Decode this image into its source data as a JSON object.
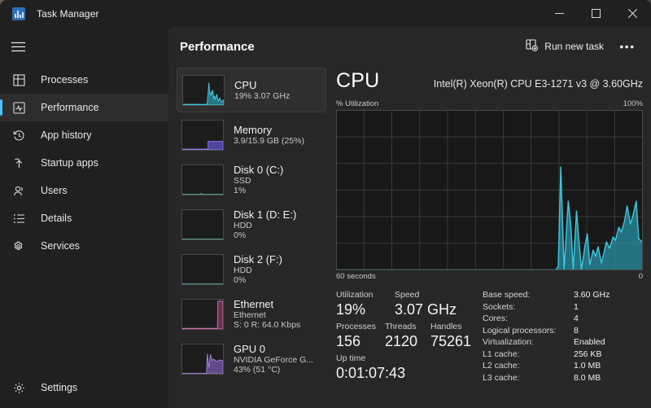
{
  "window": {
    "title": "Task Manager",
    "app_icon": "task-manager-icon",
    "minimize_label": "Minimize",
    "maximize_label": "Maximize",
    "close_label": "Close"
  },
  "sidebar": {
    "menu_icon": "hamburger-icon",
    "items": [
      {
        "label": "Processes",
        "icon": "processes-icon",
        "selected": false
      },
      {
        "label": "Performance",
        "icon": "performance-icon",
        "selected": true
      },
      {
        "label": "App history",
        "icon": "history-icon",
        "selected": false
      },
      {
        "label": "Startup apps",
        "icon": "startup-icon",
        "selected": false
      },
      {
        "label": "Users",
        "icon": "users-icon",
        "selected": false
      },
      {
        "label": "Details",
        "icon": "details-icon",
        "selected": false
      },
      {
        "label": "Services",
        "icon": "services-icon",
        "selected": false
      }
    ],
    "settings": {
      "label": "Settings",
      "icon": "gear-icon"
    }
  },
  "header": {
    "title": "Performance",
    "run_new_task": "Run new task",
    "run_new_task_icon": "run-new-task-icon",
    "more_label": "•••"
  },
  "resources": [
    {
      "name": "CPU",
      "line1": "19%  3.07 GHz",
      "line2": "",
      "selected": true,
      "color": "#3ec8e0"
    },
    {
      "name": "Memory",
      "line1": "3.9/15.9 GB (25%)",
      "line2": "",
      "selected": false,
      "color": "#8f7fe8"
    },
    {
      "name": "Disk 0 (C:)",
      "line1": "SSD",
      "line2": "1%",
      "selected": false,
      "color": "#4f9e8f"
    },
    {
      "name": "Disk 1 (D: E:)",
      "line1": "HDD",
      "line2": "0%",
      "selected": false,
      "color": "#4f9e8f"
    },
    {
      "name": "Disk 2 (F:)",
      "line1": "HDD",
      "line2": "0%",
      "selected": false,
      "color": "#4f9e8f"
    },
    {
      "name": "Ethernet",
      "line1": "Ethernet",
      "line2": "S: 0 R: 64.0 Kbps",
      "selected": false,
      "color": "#d96fb0"
    },
    {
      "name": "GPU 0",
      "line1": "NVIDIA GeForce G...",
      "line2": "43% (51 °C)",
      "selected": false,
      "color": "#a585d8"
    }
  ],
  "cpu": {
    "title": "CPU",
    "model": "Intel(R) Xeon(R) CPU E3-1271 v3 @ 3.60GHz",
    "graph_label": "% Utilization",
    "graph_max": "100%",
    "axis_left": "60 seconds",
    "axis_right": "0",
    "accent": "#3ec8e0",
    "stats": {
      "utilization_label": "Utilization",
      "utilization_value": "19%",
      "speed_label": "Speed",
      "speed_value": "3.07 GHz",
      "processes_label": "Processes",
      "processes_value": "156",
      "threads_label": "Threads",
      "threads_value": "2120",
      "handles_label": "Handles",
      "handles_value": "75261",
      "uptime_label": "Up time",
      "uptime_value": "0:01:07:43"
    },
    "specs": [
      {
        "key": "Base speed:",
        "value": "3.60 GHz"
      },
      {
        "key": "Sockets:",
        "value": "1"
      },
      {
        "key": "Cores:",
        "value": "4"
      },
      {
        "key": "Logical processors:",
        "value": "8"
      },
      {
        "key": "Virtualization:",
        "value": "Enabled"
      },
      {
        "key": "L1 cache:",
        "value": "256 KB"
      },
      {
        "key": "L2 cache:",
        "value": "1.0 MB"
      },
      {
        "key": "L3 cache:",
        "value": "8.0 MB"
      }
    ]
  },
  "chart_data": {
    "type": "area",
    "title": "% Utilization",
    "xlabel": "60 seconds",
    "ylabel": "% Utilization",
    "ylim": [
      0,
      100
    ],
    "xlim": [
      60,
      0
    ],
    "grid": true,
    "accent_color": "#3ec8e0",
    "note": "History only populated for the most recent ~16 seconds; earlier samples are zero.",
    "x_seconds_ago": [
      60,
      58,
      56,
      54,
      52,
      50,
      48,
      46,
      44,
      42,
      40,
      38,
      36,
      34,
      32,
      30,
      28,
      26,
      24,
      22,
      20,
      18,
      16.5,
      16,
      15.5,
      15,
      14.5,
      14,
      13.5,
      13,
      12.5,
      12,
      11.5,
      11,
      10.5,
      10,
      9.5,
      9,
      8.5,
      8,
      7.5,
      7,
      6.5,
      6,
      5.5,
      5,
      4.5,
      4,
      3.5,
      3,
      2.5,
      2,
      1.5,
      1,
      0.5,
      0
    ],
    "values": [
      0,
      0,
      0,
      0,
      0,
      0,
      0,
      0,
      0,
      0,
      0,
      0,
      0,
      0,
      0,
      0,
      0,
      0,
      0,
      0,
      0,
      0,
      0,
      2,
      58,
      30,
      10,
      8,
      5,
      38,
      12,
      6,
      34,
      10,
      20,
      5,
      3,
      6,
      18,
      9,
      4,
      12,
      14,
      7,
      10,
      16,
      9,
      6,
      12,
      20,
      22,
      17,
      26,
      41,
      30,
      19
    ]
  }
}
